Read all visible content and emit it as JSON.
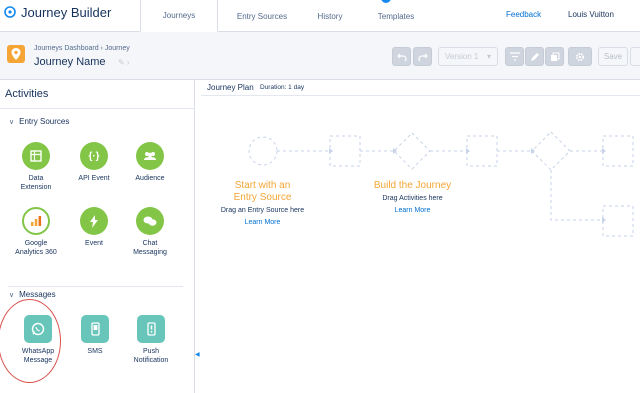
{
  "app": {
    "title": "Journey Builder"
  },
  "nav": {
    "tabs": [
      "Journeys",
      "Entry Sources",
      "History",
      "Templates"
    ],
    "feedback": "Feedback",
    "user": "Louis Vuitton"
  },
  "header": {
    "breadcrumb": "Journeys Dashboard › Journey",
    "journey_name": "Journey Name",
    "version": "Version 1",
    "save": "Save"
  },
  "activities": {
    "title": "Activities",
    "entry_sources": {
      "title": "Entry Sources",
      "items": [
        {
          "label": "Data\nExtension",
          "icon": "table-icon"
        },
        {
          "label": "API Event",
          "icon": "braces-icon"
        },
        {
          "label": "Audience",
          "icon": "people-icon"
        },
        {
          "label": "Google\nAnalytics 360",
          "icon": "bar-chart-icon"
        },
        {
          "label": "Event",
          "icon": "lightning-icon"
        },
        {
          "label": "Chat\nMessaging",
          "icon": "chat-icon"
        }
      ]
    },
    "messages": {
      "title": "Messages",
      "items": [
        {
          "label": "WhatsApp\nMessage",
          "icon": "whatsapp-icon"
        },
        {
          "label": "SMS",
          "icon": "phone-icon"
        },
        {
          "label": "Push\nNotification",
          "icon": "push-icon"
        }
      ]
    }
  },
  "canvas": {
    "title": "Journey Plan",
    "duration": "Duration: 1 day",
    "entry_cta": {
      "title": "Start with an\nEntry Source",
      "sub": "Drag an Entry Source here",
      "more": "Learn More"
    },
    "build_cta": {
      "title": "Build the Journey",
      "sub": "Drag Activities here",
      "more": "Learn More"
    }
  },
  "colors": {
    "accent": "#1589ee",
    "orange": "#f4a535",
    "green": "#83c547",
    "teal": "#67c5b9"
  }
}
